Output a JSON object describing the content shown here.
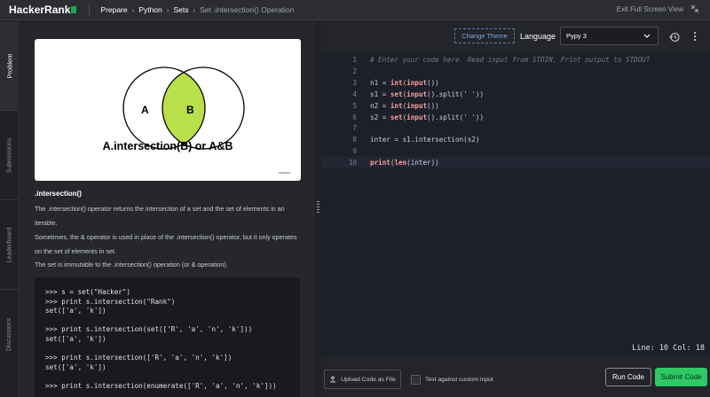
{
  "header": {
    "logo_text": "HackerRank",
    "breadcrumbs": [
      "Prepare",
      "Python",
      "Sets"
    ],
    "current_page": "Set .intersection() Operation",
    "exit_label": "Exit Full Screen View"
  },
  "sidebar": {
    "tabs": [
      "Problem",
      "Submissions",
      "Leaderboard",
      "Discussions"
    ]
  },
  "problem": {
    "venn": {
      "left_label": "A",
      "right_label": "B",
      "caption": "A.intersection(B) or A&B",
      "credit": "SLIDESM",
      "highlight_color": "#b9e04a"
    },
    "title": ".intersection()",
    "paragraphs": [
      "The .intersection() operator returns the intersection of a set and the set of elements in an iterable.",
      "Sometimes, the & operator is used in place of the .intersection() operator, but it only operates on the set of elements in set.",
      "The set is immutable to the .intersection() operation (or & operation)."
    ],
    "example_code": ">>> s = set(\"Hacker\")\n>>> print s.intersection(\"Rank\")\nset(['a', 'k'])\n\n>>> print s.intersection(set(['R', 'a', 'n', 'k']))\nset(['a', 'k'])\n\n>>> print s.intersection(['R', 'a', 'n', 'k'])\nset(['a', 'k'])\n\n>>> print s.intersection(enumerate(['R', 'a', 'n', 'k']))"
  },
  "editor": {
    "change_theme_label": "Change Theme",
    "language_label": "Language",
    "language_value": "Pypy 3",
    "line_numbers": [
      "1",
      "2",
      "3",
      "4",
      "5",
      "6",
      "7",
      "8",
      "9",
      "10"
    ],
    "code_lines": [
      "# Enter your code here. Read input from STDIN. Print output to STDOUT",
      "",
      "n1 = int(input())",
      "s1 = set(input().split(' '))",
      "n2 = int(input())",
      "s2 = set(input().split(' '))",
      "",
      "inter = s1.intersection(s2)",
      "",
      "print(len(inter))"
    ],
    "status": "Line: 10 Col: 18"
  },
  "footer": {
    "upload_label": "Upload Code as File",
    "custom_input_label": "Test against custom input",
    "run_label": "Run Code",
    "submit_label": "Submit Code",
    "submit_color": "#2ec866"
  }
}
